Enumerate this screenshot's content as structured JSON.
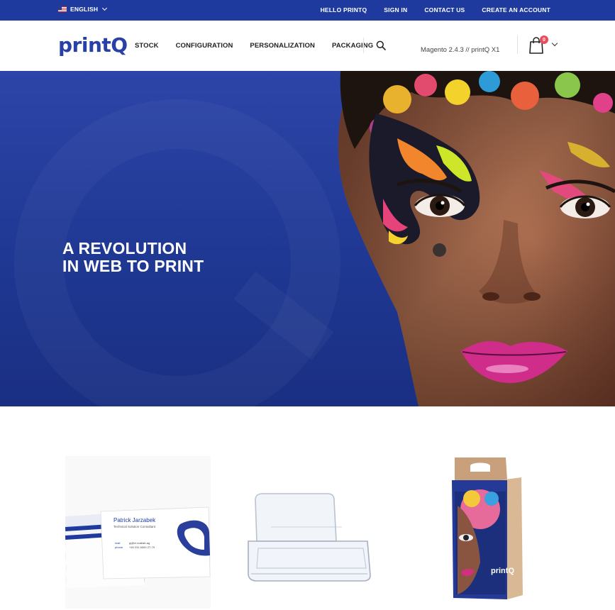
{
  "topbar": {
    "language": "ENGLISH",
    "links": [
      "HELLO PRINTQ",
      "SIGN IN",
      "CONTACT US",
      "CREATE AN ACCOUNT"
    ]
  },
  "header": {
    "logo": "printQ",
    "nav": [
      "STOCK",
      "CONFIGURATION",
      "PERSONALIZATION",
      "PACKAGING"
    ],
    "version": "Magento 2.4.3 // printQ X1",
    "cart_count": "0"
  },
  "hero": {
    "title_line1": "A REVOLUTION",
    "title_line2": "IN WEB TO PRINT"
  },
  "products": {
    "card_name": "Patrick Jarzabek",
    "card_role": "Technical Solution Consultant",
    "card_mail_label": "mail",
    "card_phone_label": "phone",
    "card_mail": "pj@cl.cvallab.ag",
    "card_phone": "+49 231 6000 27-79",
    "box_logo": "printQ"
  },
  "colors": {
    "brand_blue": "#1f3a9e",
    "badge_red": "#ea4c5b"
  },
  "icons": [
    "us-flag-icon",
    "chevron-down-icon",
    "search-icon",
    "shopping-bag-icon",
    "chevron-down-icon"
  ]
}
